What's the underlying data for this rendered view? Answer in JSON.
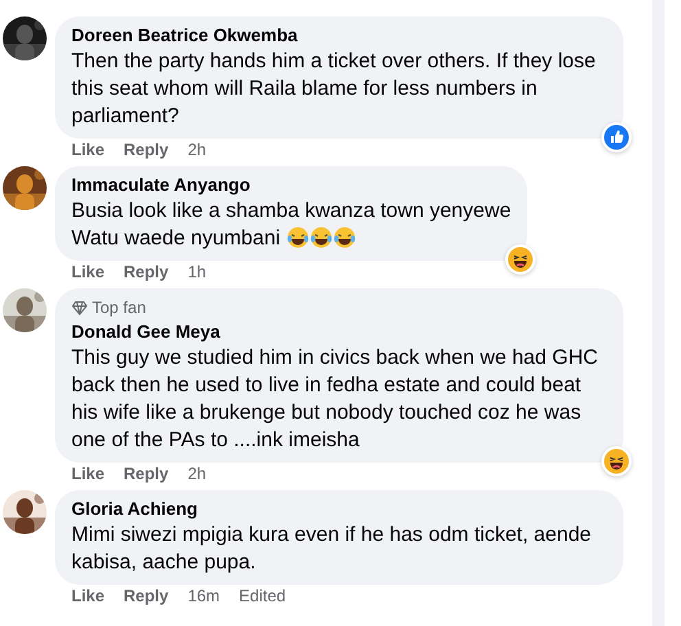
{
  "comments": [
    {
      "author": "Doreen Beatrice Okwemba",
      "body": "Then the party hands him a ticket over others. If they lose this seat whom will Raila blame for less numbers in parliament?",
      "actions": {
        "like": "Like",
        "reply": "Reply",
        "time": "2h"
      },
      "reaction": {
        "kind": "like"
      }
    },
    {
      "author": "Immaculate Anyango",
      "body": "Busia look like a shamba kwanza town yenyewe\nWatu waede nyumbani",
      "emojis": [
        {
          "kind": "tears-of-joy"
        },
        {
          "kind": "tears-of-joy"
        },
        {
          "kind": "tears-of-joy"
        }
      ],
      "actions": {
        "like": "Like",
        "reply": "Reply",
        "time": "1h"
      },
      "reaction": {
        "kind": "haha"
      }
    },
    {
      "badge": "Top fan",
      "author": "Donald Gee Meya",
      "body": "This guy we studied him in civics back when we had GHC back then he used to live in fedha estate and could beat his wife like a brukenge but nobody touched coz he was one of the PAs to ....ink imeisha",
      "actions": {
        "like": "Like",
        "reply": "Reply",
        "time": "2h"
      },
      "reaction": {
        "kind": "haha"
      }
    },
    {
      "author": "Gloria Achieng",
      "body": "Mimi siwezi mpigia kura even if he has odm ticket, aende kabisa, aache pupa.",
      "actions": {
        "like": "Like",
        "reply": "Reply",
        "time": "16m",
        "edited": "Edited"
      }
    }
  ]
}
